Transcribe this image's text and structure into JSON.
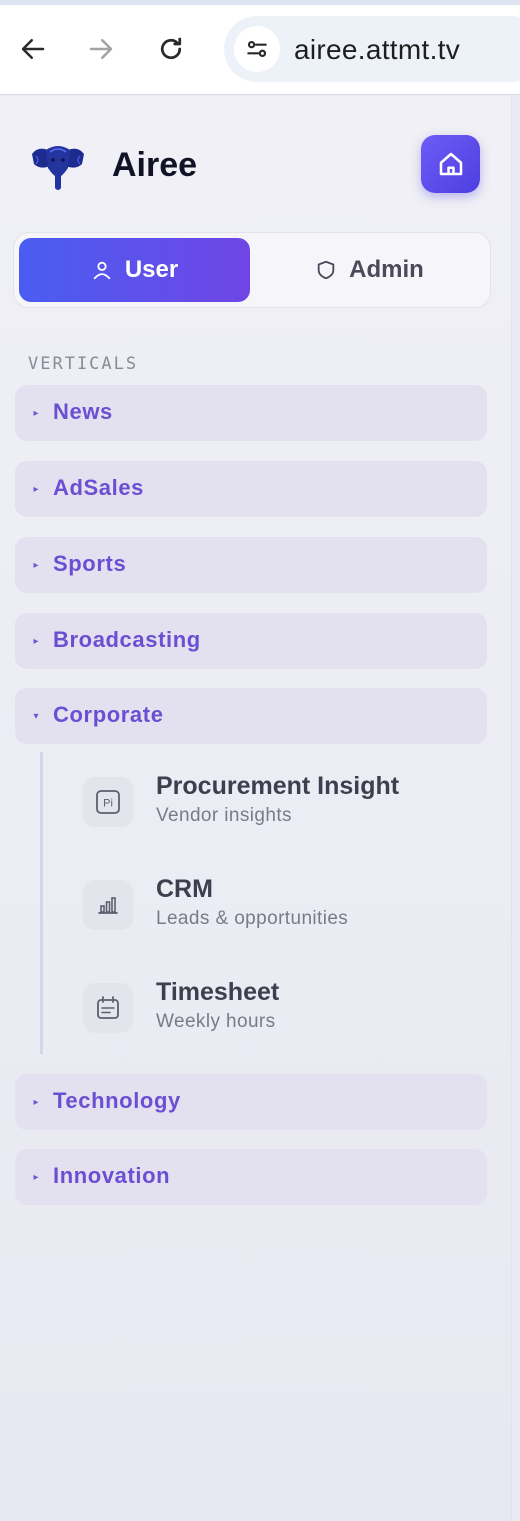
{
  "browser": {
    "url": "airee.attmt.tv",
    "icons": [
      "back-arrow-icon",
      "forward-arrow-icon",
      "reload-icon",
      "site-settings-icon"
    ]
  },
  "brand": {
    "name": "Airee",
    "logo_icon": "elephant-logo",
    "home_icon": "home-icon",
    "accent": "#5b4ff0"
  },
  "role_toggle": {
    "user_label": "User",
    "admin_label": "Admin",
    "selected": "User"
  },
  "sidebar": {
    "section_label": "VERTICALS",
    "verticals": [
      {
        "label": "News",
        "expanded": false
      },
      {
        "label": "AdSales",
        "expanded": false
      },
      {
        "label": "Sports",
        "expanded": false
      },
      {
        "label": "Broadcasting",
        "expanded": false
      },
      {
        "label": "Corporate",
        "expanded": true
      },
      {
        "label": "Technology",
        "expanded": false
      },
      {
        "label": "Innovation",
        "expanded": false
      }
    ],
    "corporate_items": [
      {
        "title": "Procurement Insight",
        "description": "Vendor insights",
        "icon": "pi-badge-icon"
      },
      {
        "title": "CRM",
        "description": "Leads & opportunities",
        "icon": "bar-chart-icon"
      },
      {
        "title": "Timesheet",
        "description": "Weekly hours",
        "icon": "calendar-icon"
      }
    ]
  }
}
